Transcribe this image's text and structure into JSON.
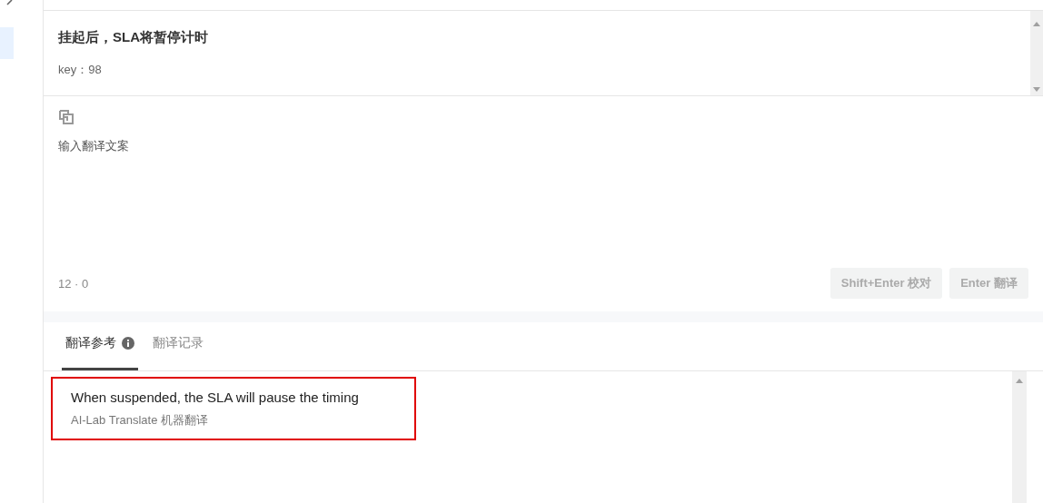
{
  "sidebar": {
    "items": [
      {
        "selected": true
      }
    ]
  },
  "source": {
    "text": "挂起后，SLA将暂停计时",
    "key": "key：98"
  },
  "editor": {
    "placeholder": "输入翻译文案",
    "counter": "12 · 0",
    "buttons": [
      {
        "label": "Shift+Enter 校对",
        "disabled": true
      },
      {
        "label": "Enter 翻译",
        "disabled": true
      }
    ]
  },
  "tabs": [
    {
      "label": "翻译参考",
      "selected": true,
      "info": true
    },
    {
      "label": "翻译记录",
      "selected": false,
      "info": false
    }
  ],
  "results": [
    {
      "text": "When suspended, the SLA will pause the timing",
      "source": "AI-Lab Translate 机器翻译",
      "highlighted": true
    }
  ]
}
